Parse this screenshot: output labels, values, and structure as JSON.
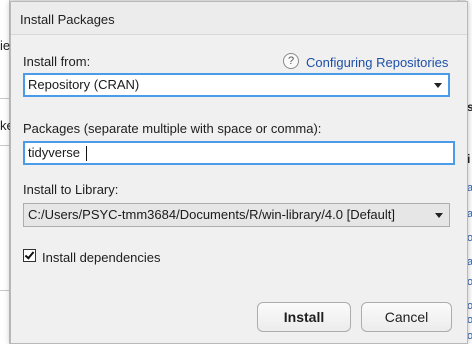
{
  "dialog": {
    "title": "Install Packages",
    "install_from": {
      "label": "Install from:",
      "help_icon": "?",
      "help_link": "Configuring Repositories",
      "selected": "Repository (CRAN)"
    },
    "packages": {
      "label": "Packages (separate multiple with space or comma):",
      "value": "tidyverse"
    },
    "library": {
      "label": "Install to Library:",
      "selected": "C:/Users/PSYC-tmm3684/Documents/R/win-library/4.0 [Default]"
    },
    "dependencies": {
      "label": "Install dependencies",
      "checked": true
    },
    "buttons": {
      "install": "Install",
      "cancel": "Cancel"
    }
  },
  "background": {
    "left_fragments": [
      "ie",
      "ke"
    ],
    "right_fragments": [
      "st",
      "i",
      "as",
      "as",
      "o",
      "as",
      "o",
      "o",
      "o",
      "o"
    ]
  }
}
